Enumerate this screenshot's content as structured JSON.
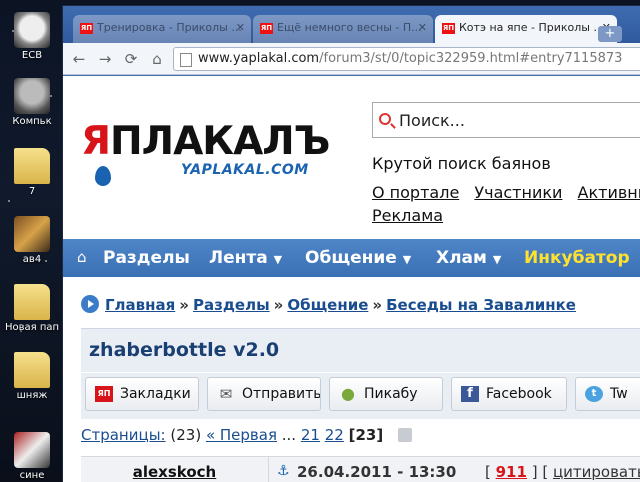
{
  "desktop": {
    "icons": [
      {
        "label": "ЕСВ",
        "icon": "troll-face-icon"
      },
      {
        "label": "Компьк",
        "icon": "computer-icon"
      },
      {
        "label": "7",
        "icon": "folder-icon"
      },
      {
        "label": "ав4",
        "icon": "image-icon"
      },
      {
        "label": "Новая пап",
        "icon": "folder-icon"
      },
      {
        "label": "шняж",
        "icon": "folder-icon"
      },
      {
        "label": "сине",
        "icon": "image-icon"
      }
    ]
  },
  "browser": {
    "tabs": [
      {
        "title": "Тренировка - Приколы ...",
        "favicon": "ЯП",
        "active": false
      },
      {
        "title": "Ещё немного весны - П...",
        "favicon": "ЯП",
        "active": false
      },
      {
        "title": "Котэ на япе - Приколы ...",
        "favicon": "ЯП",
        "active": true
      }
    ],
    "url_domain": "www.yaplakal.com",
    "url_path": "/forum3/st/0/topic322959.html#entry7115873"
  },
  "site": {
    "logo_text_red": "Я",
    "logo_text": "ПЛАКАЛЪ",
    "logo_sub": "YAPLAKAL.COM",
    "search_placeholder": "Поиск...",
    "tagline": "Крутой поиск баянов",
    "top_links": [
      "О портале",
      "Участники",
      "Активные"
    ],
    "reklama": "Реклама",
    "menu": [
      {
        "label": "Разделы",
        "dropdown": false,
        "accent": false
      },
      {
        "label": "Лента",
        "dropdown": true,
        "accent": false
      },
      {
        "label": "Общение",
        "dropdown": true,
        "accent": false
      },
      {
        "label": "Хлам",
        "dropdown": true,
        "accent": false
      },
      {
        "label": "Инкубатор",
        "dropdown": false,
        "accent": true
      }
    ],
    "breadcrumbs": [
      "Главная",
      "Разделы",
      "Общение",
      "Беседы на Завалинке"
    ],
    "breadcrumb_sep": "»",
    "topic_title": "zhaberbottle v2.0",
    "share": [
      {
        "label": "Закладки",
        "icon": "yp-bookmark-icon",
        "glyph": "ЯП"
      },
      {
        "label": "Отправить",
        "icon": "envelope-icon",
        "glyph": "✉"
      },
      {
        "label": "Пикабу",
        "icon": "pikabu-icon",
        "glyph": "●"
      },
      {
        "label": "Facebook",
        "icon": "facebook-icon",
        "glyph": "f"
      },
      {
        "label": "Tw",
        "icon": "twitter-icon",
        "glyph": "t"
      }
    ],
    "pagination": {
      "label": "Страницы:",
      "count": "(23)",
      "first": "« Первая",
      "ellipsis": "...",
      "pages": [
        "21",
        "22"
      ],
      "current": "[23]"
    },
    "post": {
      "author": "alexskoch",
      "anchor": "⚓",
      "date": "26.04.2011 - 13:30",
      "number": "911",
      "cite": "цитировать"
    }
  },
  "colors": {
    "brand_red": "#d8141b",
    "brand_blue": "#1a63b0",
    "menu_blue": "#3a70b4",
    "accent_yellow": "#ffe22e"
  }
}
